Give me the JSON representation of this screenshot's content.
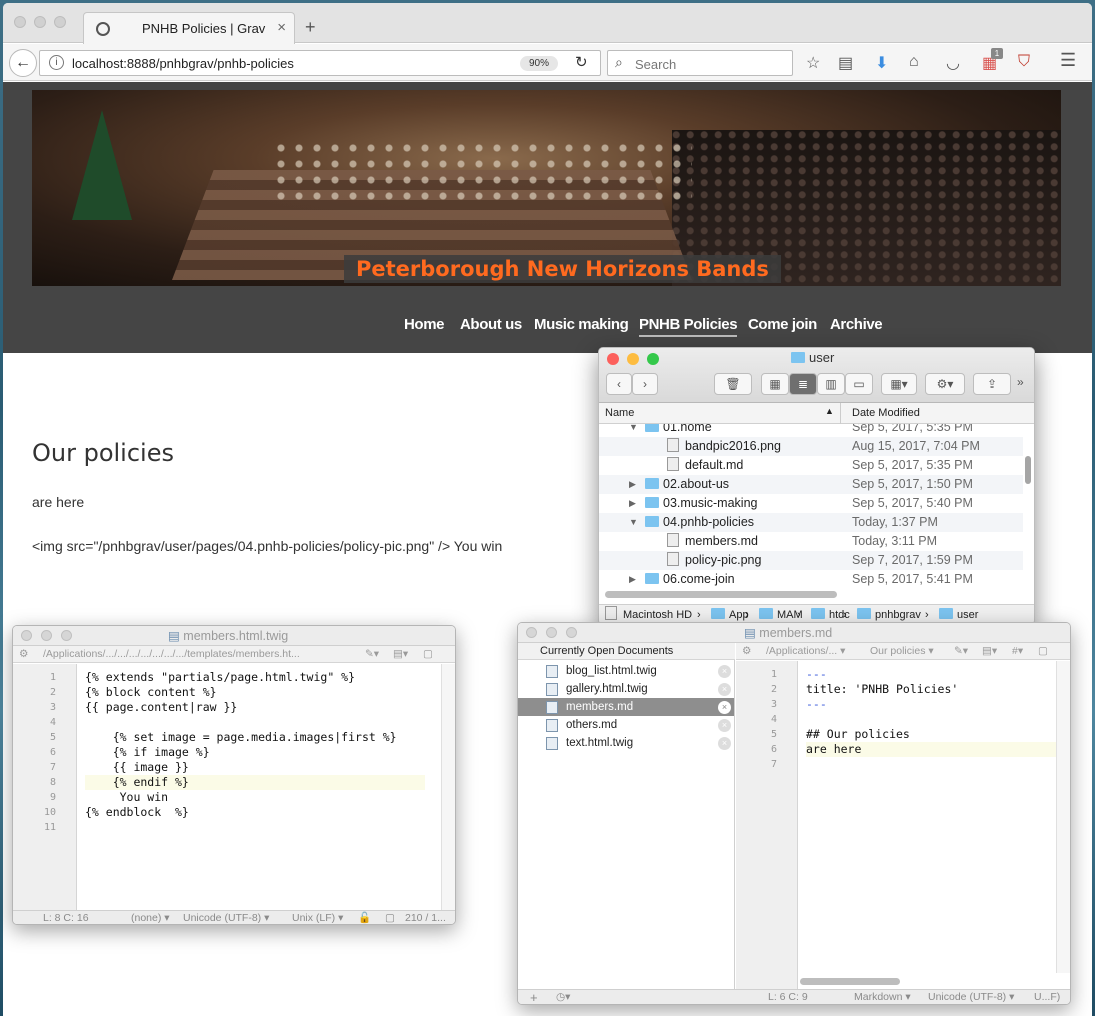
{
  "browser": {
    "tab_title": "PNHB Policies | Grav",
    "url": "localhost:8888/pnhbgrav/pnhb-policies",
    "zoom": "90%",
    "search_placeholder": "Search",
    "badge_count": "1"
  },
  "site": {
    "banner_title": "Peterborough New Horizons Bands",
    "nav": [
      "Home",
      "About us",
      "Music making",
      "PNHB Policies",
      "Come join",
      "Archive"
    ],
    "active_nav": "PNHB Policies",
    "heading": "Our policies",
    "para1": "are here",
    "para2": "<img src=\"/pnhbgrav/user/pages/04.pnhb-policies/policy-pic.png\" /> You win"
  },
  "finder": {
    "title": "user",
    "col_name": "Name",
    "col_date": "Date Modified",
    "rows": [
      {
        "name": "01.home",
        "date": "Sep 5, 2017, 5:35 PM",
        "kind": "folder",
        "level": 1,
        "expanded": true
      },
      {
        "name": "bandpic2016.png",
        "date": "Aug 15, 2017, 7:04 PM",
        "kind": "file",
        "level": 2
      },
      {
        "name": "default.md",
        "date": "Sep 5, 2017, 5:35 PM",
        "kind": "file",
        "level": 2
      },
      {
        "name": "02.about-us",
        "date": "Sep 5, 2017, 1:50 PM",
        "kind": "folder",
        "level": 1,
        "expanded": false
      },
      {
        "name": "03.music-making",
        "date": "Sep 5, 2017, 5:40 PM",
        "kind": "folder",
        "level": 1,
        "expanded": false
      },
      {
        "name": "04.pnhb-policies",
        "date": "Today, 1:37 PM",
        "kind": "folder",
        "level": 1,
        "expanded": true
      },
      {
        "name": "members.md",
        "date": "Today, 3:11 PM",
        "kind": "file",
        "level": 2
      },
      {
        "name": "policy-pic.png",
        "date": "Sep 7, 2017, 1:59 PM",
        "kind": "file",
        "level": 2
      },
      {
        "name": "06.come-join",
        "date": "Sep 5, 2017, 5:41 PM",
        "kind": "folder",
        "level": 1,
        "expanded": false
      }
    ],
    "path": [
      "Macintosh HD",
      "App",
      "MAM",
      "htdc",
      "pnhbgrav",
      "user"
    ]
  },
  "twig_editor": {
    "title": "members.html.twig",
    "path": "/Applications/.../.../.../.../.../.../.../templates/members.ht...",
    "lines": [
      "{% extends \"partials/page.html.twig\" %}",
      "{% block content %}",
      "{{ page.content|raw }}",
      "",
      "    {% set image = page.media.images|first %}",
      "    {% if image %}",
      "    {{ image }}",
      "    {% endif %}",
      "     You win",
      "{% endblock  %}",
      ""
    ],
    "current_line": 8,
    "status": {
      "pos": "L: 8 C: 16",
      "lang": "(none)",
      "enc": "Unicode (UTF-8)",
      "eol": "Unix (LF)",
      "size": "210 / 1..."
    }
  },
  "md_editor": {
    "title": "members.md",
    "docs_header": "Currently Open Documents",
    "docs": [
      "blog_list.html.twig",
      "gallery.html.twig",
      "members.md",
      "others.md",
      "text.html.twig"
    ],
    "selected_doc": "members.md",
    "path": "/Applications/...",
    "func_menu": "Our policies",
    "lines": [
      "---",
      "title: 'PNHB Policies'",
      "---",
      "",
      "## Our policies",
      "are here",
      ""
    ],
    "current_line": 6,
    "status": {
      "pos": "L: 6 C: 9",
      "lang": "Markdown",
      "enc": "Unicode (UTF-8)",
      "eol": "U...F)"
    }
  }
}
